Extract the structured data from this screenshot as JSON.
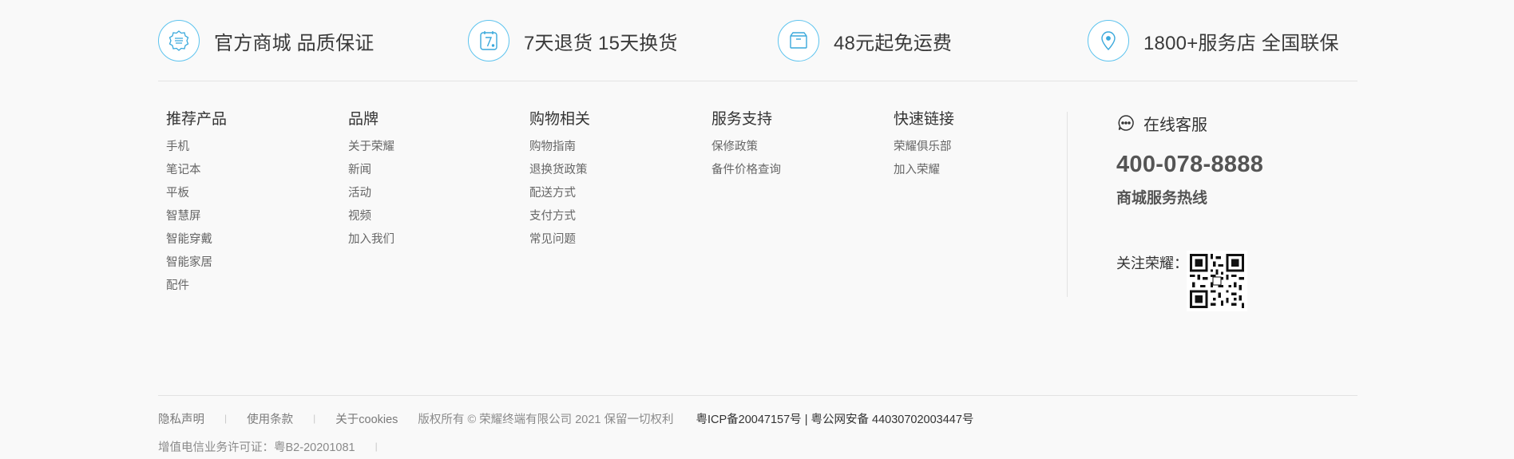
{
  "promises": [
    {
      "icon": "badge-quality-icon",
      "text": "官方商城 品质保证"
    },
    {
      "icon": "seven-day-return-icon",
      "text": "7天退货 15天换货"
    },
    {
      "icon": "box-shipping-icon",
      "text": "48元起免运费"
    },
    {
      "icon": "location-pin-icon",
      "text": "1800+服务店 全国联保"
    }
  ],
  "columns": [
    {
      "title": "推荐产品",
      "links": [
        "手机",
        "笔记本",
        "平板",
        "智慧屏",
        "智能穿戴",
        "智能家居",
        "配件"
      ]
    },
    {
      "title": "品牌",
      "links": [
        "关于荣耀",
        "新闻",
        "活动",
        "视频",
        "加入我们"
      ]
    },
    {
      "title": "购物相关",
      "links": [
        "购物指南",
        "退换货政策",
        "配送方式",
        "支付方式",
        "常见问题"
      ]
    },
    {
      "title": "服务支持",
      "links": [
        "保修政策",
        "备件价格查询"
      ]
    },
    {
      "title": "快速链接",
      "links": [
        "荣耀俱乐部",
        "加入荣耀"
      ]
    }
  ],
  "service": {
    "online_label": "在线客服",
    "phone": "400-078-8888",
    "hotline_label": "商城服务热线",
    "follow_label": "关注荣耀："
  },
  "legal": {
    "privacy": "隐私声明",
    "terms": "使用条款",
    "cookies": "关于cookies",
    "copyright": "版权所有 © 荣耀终端有限公司 2021 保留一切权利",
    "icp": "粤ICP备20047157号 | 粤公网安备 44030702003447号",
    "license": "增值电信业务许可证：粤B2-20201081",
    "separator": "|"
  },
  "colors": {
    "accent": "#5cc3ee",
    "background": "#f9f9f9",
    "divider": "#e3e3e3"
  }
}
